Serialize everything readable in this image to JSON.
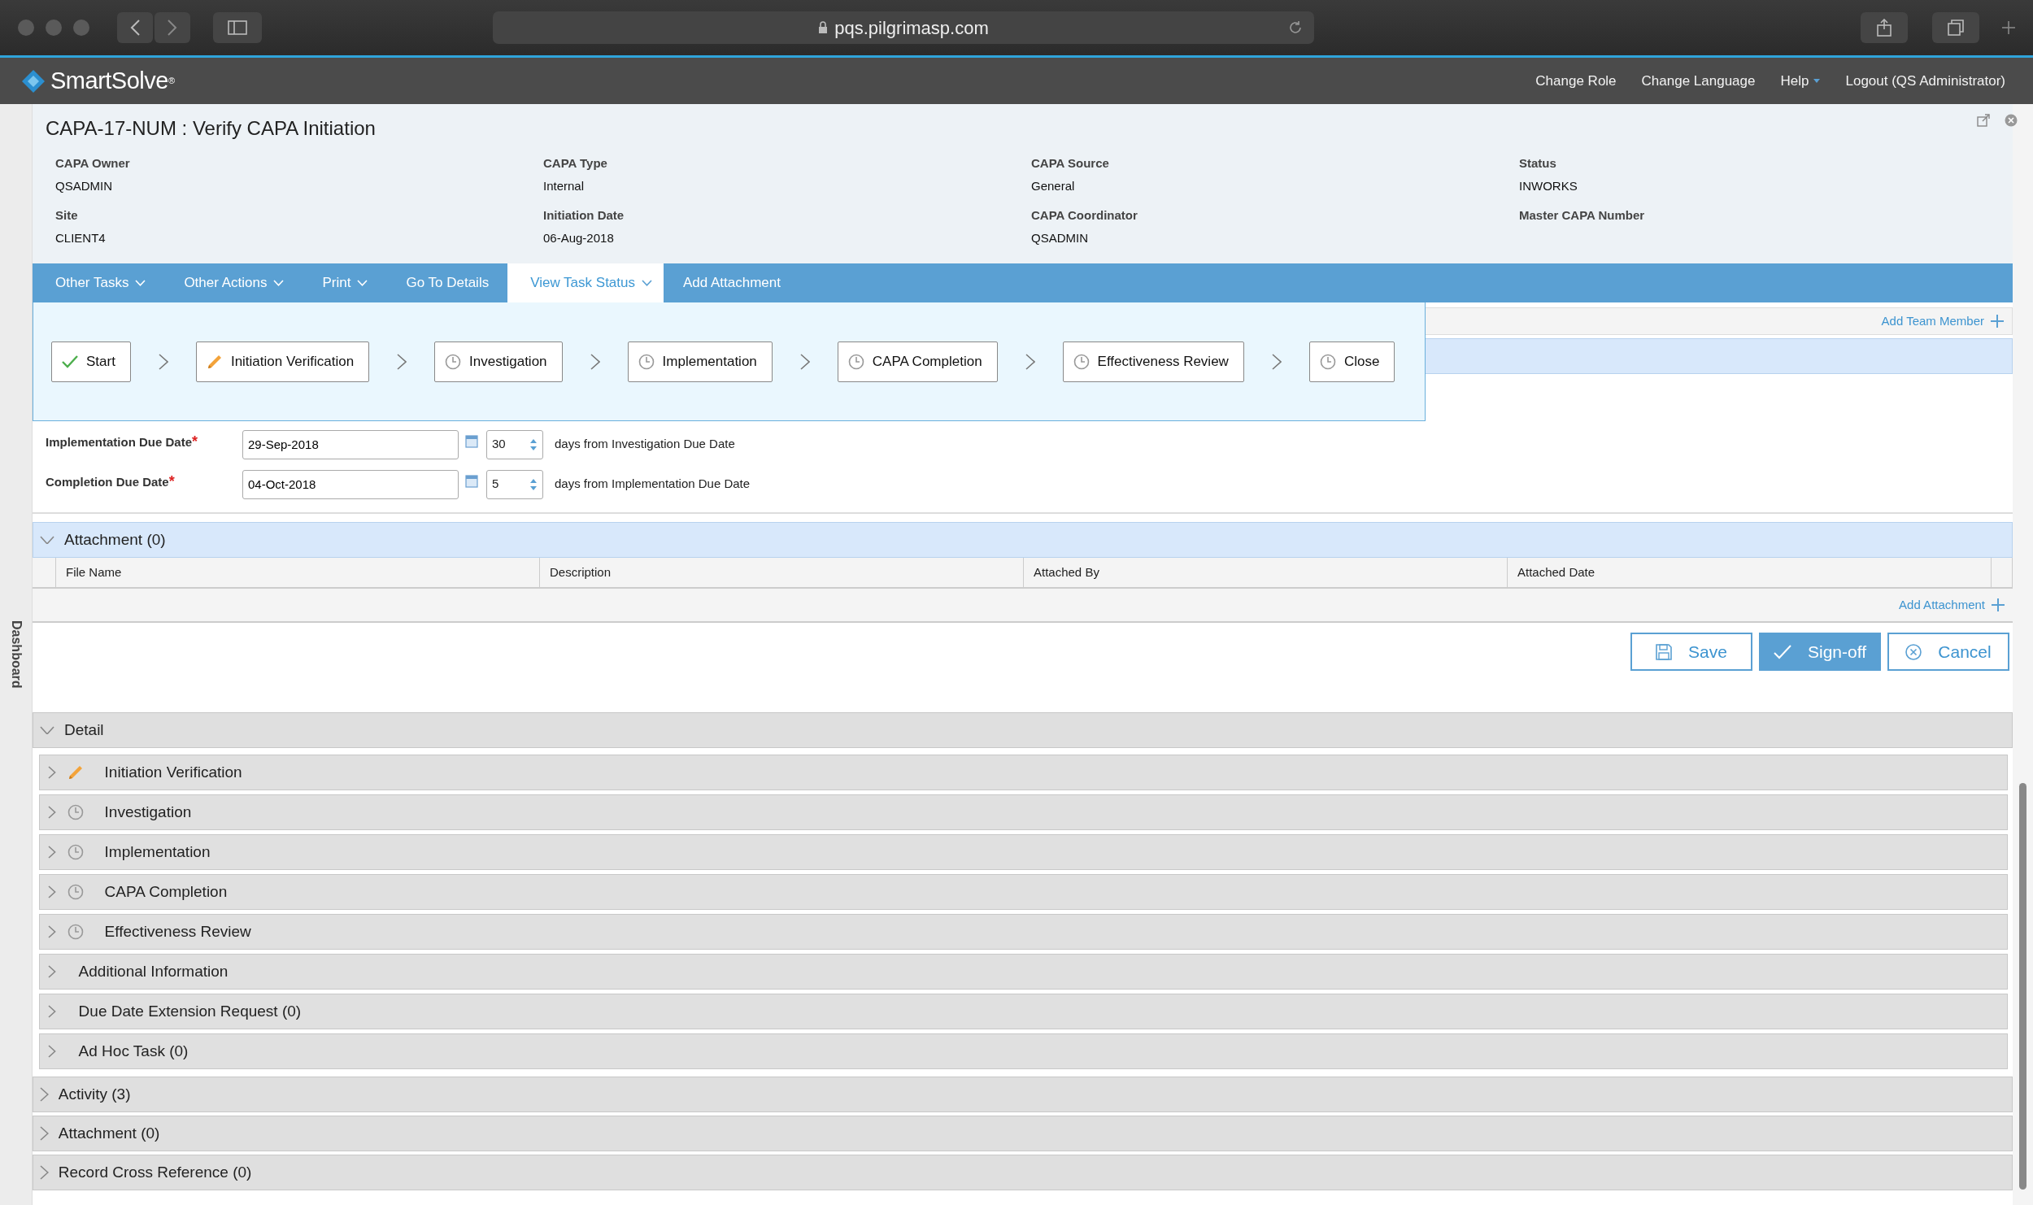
{
  "browser": {
    "url": "pqs.pilgrimasp.com"
  },
  "app": {
    "logo": "SmartSolve$^{®}$",
    "nav": [
      {
        "label": "Change Role",
        "dropdown": false
      },
      {
        "label": "Change Language",
        "dropdown": false
      },
      {
        "label": "Help",
        "dropdown": true
      },
      {
        "label": "Logout (QS Administrator)",
        "dropdown": false
      }
    ]
  },
  "sidebar": {
    "label": "Dashboard"
  },
  "record": {
    "title": "CAPA-17-NUM : Verify CAPA Initiation",
    "fields": [
      {
        "label": "CAPA Owner",
        "value": "QSADMIN"
      },
      {
        "label": "CAPA Type",
        "value": "Internal"
      },
      {
        "label": "CAPA Source",
        "value": "General"
      },
      {
        "label": "Status",
        "value": "INWORKS"
      },
      {
        "label": "Site",
        "value": "CLIENT4"
      },
      {
        "label": "Initiation Date",
        "value": "06-Aug-2018"
      },
      {
        "label": "CAPA Coordinator",
        "value": "QSADMIN"
      },
      {
        "label": "Master CAPA Number"
      }
    ]
  },
  "tabs": [
    {
      "label": "Other Tasks",
      "dropdown": true,
      "selected": false
    },
    {
      "label": "Other Actions",
      "dropdown": true,
      "selected": false
    },
    {
      "label": "Print",
      "dropdown": true,
      "selected": false
    },
    {
      "label": "Go To Details",
      "dropdown": false,
      "selected": false
    },
    {
      "label": "View Task Status",
      "dropdown": true,
      "selected": true
    },
    {
      "label": "Add Attachment",
      "dropdown": false,
      "selected": false
    }
  ],
  "task_status": {
    "steps": [
      {
        "label": "Start",
        "kind": "done"
      },
      {
        "label": "Initiation Verification",
        "kind": "active"
      },
      {
        "label": "Investigation",
        "kind": "waiting"
      },
      {
        "label": "Implementation",
        "kind": "waiting"
      },
      {
        "label": "CAPA Completion",
        "kind": "waiting"
      },
      {
        "label": "Effectiveness Review",
        "kind": "waiting"
      },
      {
        "label": "Close",
        "kind": "waiting"
      }
    ]
  },
  "team": {
    "add_link": "Add Team Member"
  },
  "due_dates": [
    {
      "label": "Implementation Due Date",
      "required_mark": "*",
      "date": "29-Sep-2018",
      "days": "30",
      "note": "days from Investigation Due Date"
    },
    {
      "label": "Completion Due Date",
      "required_mark": "*",
      "date": "04-Oct-2018",
      "days": "5",
      "note": "days from Implementation Due Date"
    }
  ],
  "attachment": {
    "title": "Attachment (0)",
    "expanded": true,
    "columns": [
      "File Name",
      "Description",
      "Attached By",
      "Attached Date"
    ],
    "add_link": "Add Attachment"
  },
  "buttons": [
    {
      "label": "Save",
      "kind": "save"
    },
    {
      "label": "Sign-off",
      "kind": "signoff"
    },
    {
      "label": "Cancel",
      "kind": "cancel"
    }
  ],
  "sections": [
    {
      "title": "Detail",
      "expanded": true,
      "children": [
        {
          "title": "Initiation Verification",
          "expanded": false,
          "kind": "active"
        },
        {
          "title": "Investigation",
          "expanded": false,
          "kind": "waiting"
        },
        {
          "title": "Implementation",
          "expanded": false,
          "kind": "waiting"
        },
        {
          "title": "CAPA Completion",
          "expanded": false,
          "kind": "waiting"
        },
        {
          "title": "Effectiveness Review",
          "expanded": false,
          "kind": "waiting"
        },
        {
          "title": "Additional Information",
          "expanded": false,
          "kind": "plain"
        },
        {
          "title": "Due Date Extension Request (0)",
          "expanded": false,
          "kind": "plain"
        },
        {
          "title": "Ad Hoc Task (0)",
          "expanded": false,
          "kind": "plain"
        }
      ]
    },
    {
      "title": "Activity (3)",
      "expanded": false
    },
    {
      "title": "Attachment (0)",
      "expanded": false
    },
    {
      "title": "Record Cross Reference (0)",
      "expanded": false
    }
  ]
}
